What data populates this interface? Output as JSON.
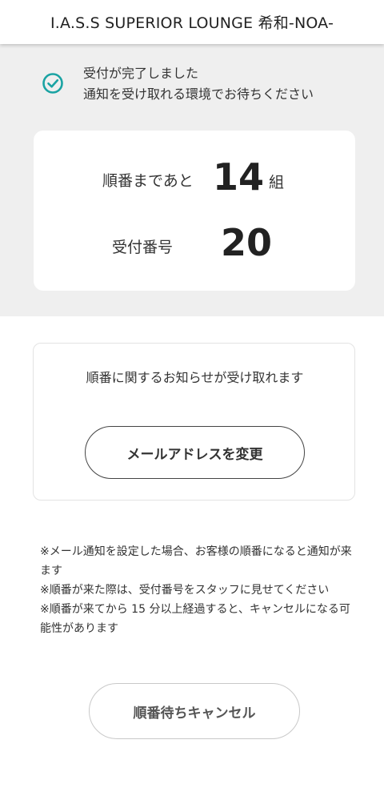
{
  "header": {
    "title": "I.A.S.S SUPERIOR LOUNGE 希和-NOA-"
  },
  "status": {
    "icon": "check-circle-icon",
    "accent_color": "#1aa3a3",
    "message_line1": "受付が完了しました",
    "message_line2": "通知を受け取れる環境でお待ちください"
  },
  "ticket": {
    "wait_label": "順番まであと",
    "wait_count": "14",
    "wait_unit": "組",
    "number_label": "受付番号",
    "number_value": "20"
  },
  "mail": {
    "description": "順番に関するお知らせが受け取れます",
    "change_button_label": "メールアドレスを変更"
  },
  "notes": [
    "※メール通知を設定した場合、お客様の順番になると通知が来ます",
    "※順番が来た際は、受付番号をスタッフに見せてください",
    "※順番が来てから 15 分以上経過すると、キャンセルになる可能性があります"
  ],
  "cancel_button_label": "順番待ちキャンセル"
}
